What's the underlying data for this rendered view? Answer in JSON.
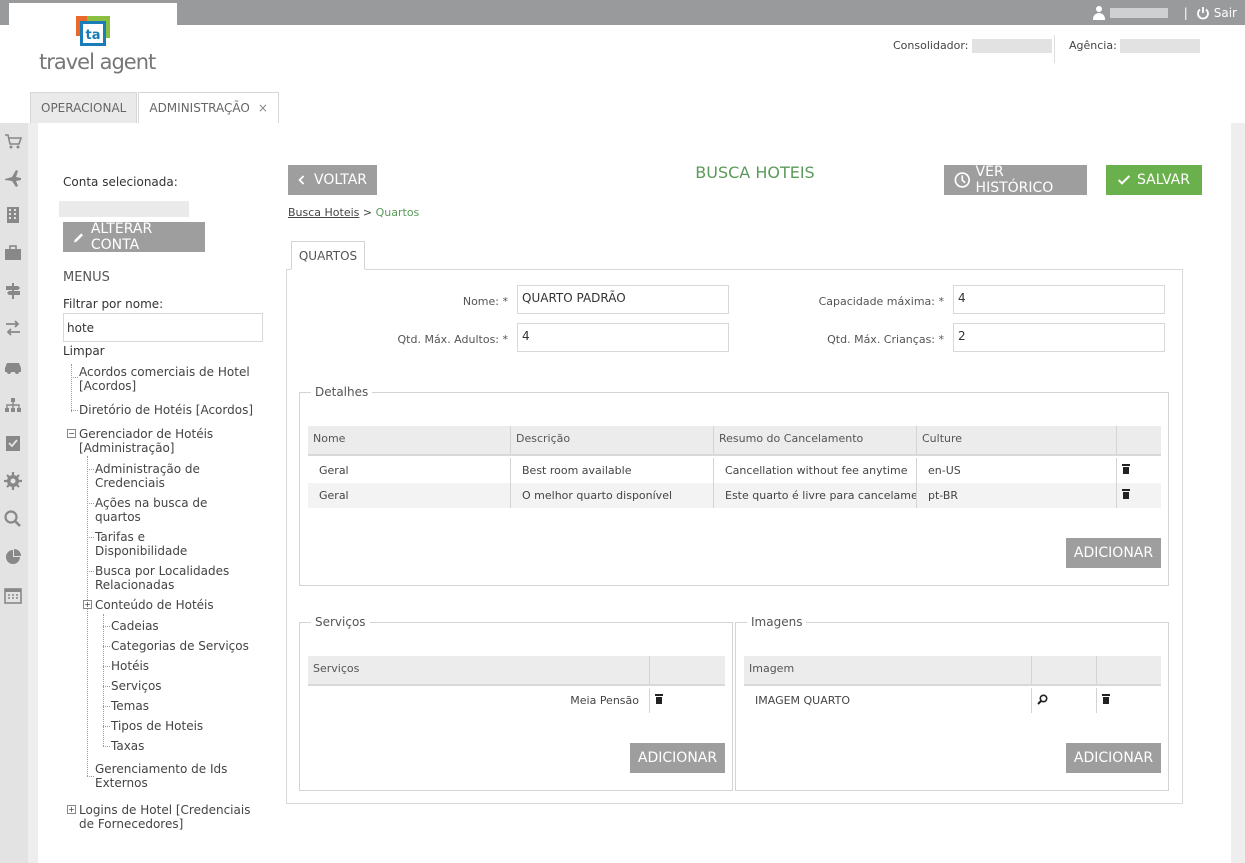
{
  "topbar": {
    "logout_label": "Sair",
    "separator": "|"
  },
  "header": {
    "logo_text": "travel agent",
    "logo_mark": "ta",
    "consolidador_label": "Consolidador:",
    "agencia_label": "Agência:"
  },
  "tabs": [
    {
      "label": "OPERACIONAL"
    },
    {
      "label": "ADMINISTRAÇÃO",
      "close": "×"
    }
  ],
  "side": {
    "conta_label": "Conta selecionada:",
    "alterar_label": "ALTERAR CONTA",
    "menus_title": "MENUS",
    "filtrar_label": "Filtrar por nome:",
    "filtro_value": "hote",
    "limpar_label": "Limpar",
    "tree": [
      "Acordos comerciais de Hotel [Acordos]",
      "Diretório de Hotéis [Acordos]",
      "Gerenciador de Hotéis [Administração]",
      "Administração de Credenciais",
      "Ações na busca de quartos",
      "Tarifas e Disponibilidade",
      "Busca por Localidades Relacionadas",
      "Conteúdo de Hotéis",
      "Cadeias",
      "Categorias de Serviços",
      "Hotéis",
      "Serviços",
      "Temas",
      "Tipos de Hoteis",
      "Taxas",
      "Gerenciamento de Ids Externos",
      "Logins de Hotel [Credenciais de Fornecedores]"
    ]
  },
  "main": {
    "voltar_label": "VOLTAR",
    "page_title": "BUSCA HOTEIS",
    "historico_label": "VER HISTÓRICO",
    "salvar_label": "SALVAR",
    "breadcrumb_link": "Busca Hoteis",
    "breadcrumb_sep": ">",
    "breadcrumb_current": "Quartos",
    "inner_tab": "QUARTOS",
    "form": {
      "nome_label": "Nome: *",
      "nome_value": "QUARTO PADRÃO",
      "capacidade_label": "Capacidade máxima: *",
      "capacidade_value": "4",
      "adultos_label": "Qtd. Máx. Adultos: *",
      "adultos_value": "4",
      "criancas_label": "Qtd. Máx. Crianças: *",
      "criancas_value": "2"
    },
    "detalhes": {
      "legend": "Detalhes",
      "columns": [
        "Nome",
        "Descrição",
        "Resumo do Cancelamento",
        "Culture"
      ],
      "rows": [
        [
          "Geral",
          "Best room available",
          "Cancellation without fee anytime",
          "en-US"
        ],
        [
          "Geral",
          "O melhor quarto disponível",
          "Este quarto é livre para cancelamen...",
          "pt-BR"
        ]
      ],
      "add_label": "ADICIONAR"
    },
    "servicos": {
      "legend": "Serviços",
      "column": "Serviços",
      "rows": [
        "Meia Pensão"
      ],
      "add_label": "ADICIONAR"
    },
    "imagens": {
      "legend": "Imagens",
      "column": "Imagem",
      "rows": [
        "IMAGEM QUARTO"
      ],
      "add_label": "ADICIONAR"
    }
  },
  "colors": {
    "accent_green": "#6ab04c",
    "title_green": "#5b9a5b",
    "button_gray": "#9e9e9e",
    "topbar": "#999a9c"
  }
}
